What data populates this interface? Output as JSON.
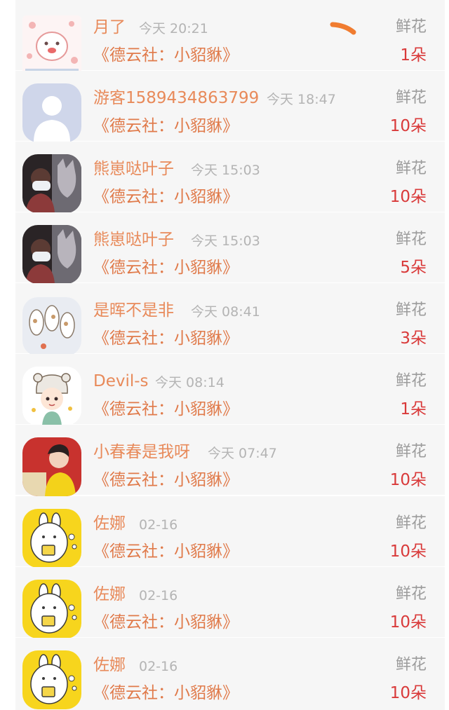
{
  "gift_list": {
    "rows": [
      {
        "name": "月了",
        "time": "今天 20:21",
        "work": "《德云社：小貂貅》",
        "gift_type": "鲜花",
        "count": "1朵",
        "avatar": "cartoon-tiger-avatar"
      },
      {
        "name": "游客1589434863799",
        "time": "今天 18:47",
        "work": "《德云社：小貂貅》",
        "gift_type": "鲜花",
        "count": "10朵",
        "avatar": "default-person-avatar"
      },
      {
        "name": "熊崽哒叶子",
        "time": "今天 15:03",
        "work": "《德云社：小貂貅》",
        "gift_type": "鲜花",
        "count": "10朵",
        "avatar": "masked-person-wolf-avatar"
      },
      {
        "name": "熊崽哒叶子",
        "time": "今天 15:03",
        "work": "《德云社：小貂貅》",
        "gift_type": "鲜花",
        "count": "5朵",
        "avatar": "masked-person-wolf-avatar"
      },
      {
        "name": "是晖不是非",
        "time": "今天 08:41",
        "work": "《德云社：小貂貅》",
        "gift_type": "鲜花",
        "count": "3朵",
        "avatar": "cats-sketch-avatar"
      },
      {
        "name": "Devil-s",
        "time": "今天 08:14",
        "work": "《德云社：小貂貅》",
        "gift_type": "鲜花",
        "count": "1朵",
        "avatar": "cartoon-girl-avatar"
      },
      {
        "name": "小春春是我呀",
        "time": "今天 07:47",
        "work": "《德云社：小貂貅》",
        "gift_type": "鲜花",
        "count": "10朵",
        "avatar": "red-photo-avatar"
      },
      {
        "name": "佐娜",
        "time": "02-16",
        "work": "《德云社：小貂貅》",
        "gift_type": "鲜花",
        "count": "10朵",
        "avatar": "yellow-bunny-avatar"
      },
      {
        "name": "佐娜",
        "time": "02-16",
        "work": "《德云社：小貂貅》",
        "gift_type": "鲜花",
        "count": "10朵",
        "avatar": "yellow-bunny-avatar"
      },
      {
        "name": "佐娜",
        "time": "02-16",
        "work": "《德云社：小貂貅》",
        "gift_type": "鲜花",
        "count": "10朵",
        "avatar": "yellow-bunny-avatar"
      }
    ]
  },
  "colors": {
    "name": "#e88a5a",
    "work": "#e07a4a",
    "count": "#d93a3a",
    "gift_type": "#9c9c9c",
    "time": "#b4b4b4",
    "row_background": "#f6f6f6"
  }
}
